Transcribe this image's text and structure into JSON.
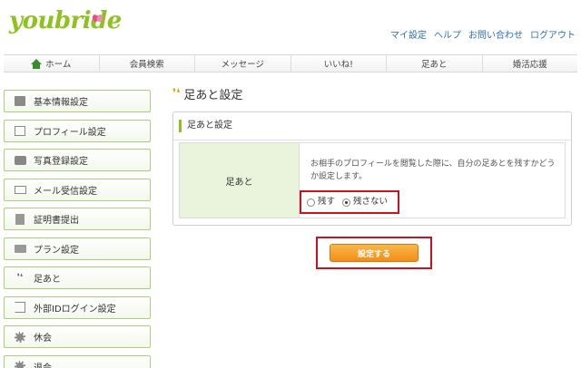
{
  "header": {
    "logo_you": "you",
    "logo_bride": "bride",
    "links": [
      "マイ設定",
      "ヘルプ",
      "お問い合わせ",
      "ログアウト"
    ]
  },
  "gnav": {
    "tabs": [
      "ホーム",
      "会員検索",
      "メッセージ",
      "いいね!",
      "足あと",
      "婚活応援"
    ]
  },
  "sidebar": {
    "items": [
      {
        "label": "基本情報設定",
        "icon": "id-card-icon"
      },
      {
        "label": "プロフィール設定",
        "icon": "edit-icon"
      },
      {
        "label": "写真登録設定",
        "icon": "camera-icon"
      },
      {
        "label": "メール受信設定",
        "icon": "mail-icon"
      },
      {
        "label": "証明書提出",
        "icon": "document-icon"
      },
      {
        "label": "プラン設定",
        "icon": "card-icon"
      },
      {
        "label": "足あと",
        "icon": "footprints-icon"
      },
      {
        "label": "外部IDログイン設定",
        "icon": "login-icon"
      },
      {
        "label": "休会",
        "icon": "gear-icon"
      },
      {
        "label": "退会",
        "icon": "gear-icon"
      }
    ]
  },
  "main": {
    "title": "足あと設定",
    "panel_heading": "足あと設定",
    "row_label": "足あと",
    "description": "お相手のプロフィールを閲覧した際に、自分の足あとを残すかどうか設定します。",
    "options": [
      {
        "label": "残す",
        "selected": false
      },
      {
        "label": "残さない",
        "selected": true
      }
    ],
    "submit_label": "設定する"
  },
  "colors": {
    "brand_green": "#8dc21f",
    "link_blue": "#2a6fb5",
    "highlight_red": "#c8141e",
    "button_orange": "#f39800"
  }
}
